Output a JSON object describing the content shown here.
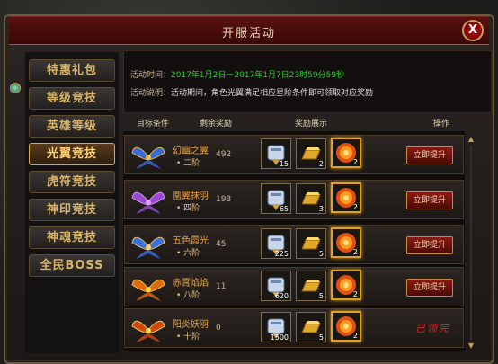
{
  "window": {
    "title": "开服活动",
    "close_label": "X"
  },
  "sidebar": {
    "items": [
      {
        "label": "特惠礼包"
      },
      {
        "label": "等级竞技"
      },
      {
        "label": "英雄等级"
      },
      {
        "label": "光翼竞技",
        "active": true
      },
      {
        "label": "虎符竞技"
      },
      {
        "label": "神印竞技"
      },
      {
        "label": "神魂竞技"
      },
      {
        "label": "全民BOSS"
      }
    ]
  },
  "info": {
    "time_label": "活动时间：",
    "time_value": "2017年1月2日－2017年1月7日23时59分59秒",
    "desc_label": "活动说明：",
    "desc_value": "活动期间，角色光翼满足相应星阶条件即可领取对应奖励"
  },
  "table": {
    "headers": {
      "target": "目标条件",
      "remaining": "剩余奖励",
      "rewards": "奖励展示",
      "action": "操作"
    },
    "rows": [
      {
        "name": "幻幽之翼",
        "level": "• 二阶",
        "remaining": "492",
        "rewards": [
          "15",
          "2",
          "2"
        ],
        "action": "立即提升",
        "wing_color": "#3a6ad8",
        "wing_accent": "#f0c040"
      },
      {
        "name": "凰翼抹羽",
        "level": "• 四阶",
        "remaining": "193",
        "rewards": [
          "65",
          "3",
          "2"
        ],
        "action": "立即提升",
        "wing_color": "#9a4ad0",
        "wing_accent": "#e0a0ff"
      },
      {
        "name": "五色霞光",
        "level": "• 六阶",
        "remaining": "45",
        "rewards": [
          "225",
          "5",
          "2"
        ],
        "action": "立即提升",
        "wing_color": "#3a70e0",
        "wing_accent": "#ffd060"
      },
      {
        "name": "赤霄焰焰",
        "level": "• 八阶",
        "remaining": "11",
        "rewards": [
          "620",
          "5",
          "2"
        ],
        "action": "立即提升",
        "wing_color": "#e06a10",
        "wing_accent": "#ffd040"
      },
      {
        "name": "阳炎妖羽",
        "level": "• 十阶",
        "remaining": "0",
        "rewards": [
          "1500",
          "5",
          "2"
        ],
        "action": "已领完",
        "done": true,
        "wing_color": "#d04a10",
        "wing_accent": "#ffe060"
      }
    ]
  },
  "icons": {
    "reward1": "scroll-icon",
    "reward2": "gold-bar-icon",
    "reward3": "fire-orb-icon",
    "wing": "wing-icon",
    "gem": "gem-icon"
  }
}
